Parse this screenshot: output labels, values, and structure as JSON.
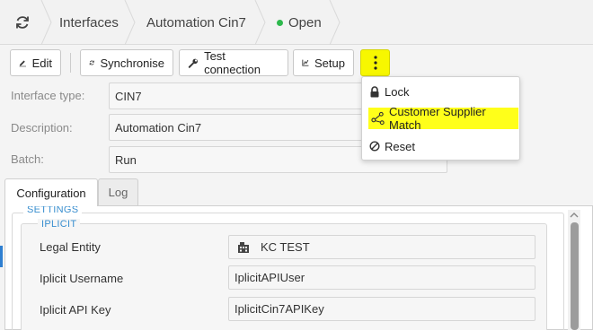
{
  "breadcrumb": {
    "items": [
      "Interfaces",
      "Automation Cin7",
      "Open"
    ],
    "status_color": "#2db84c"
  },
  "toolbar": {
    "edit_label": "Edit",
    "sync_label": "Synchronise",
    "test_label": "Test connection",
    "setup_label": "Setup",
    "more_icon": "kebab-menu-icon",
    "highlight_color": "#f7f700"
  },
  "form": {
    "type_label": "Interface type:",
    "type_value": "CIN7",
    "desc_label": "Description:",
    "desc_value": "Automation Cin7",
    "batch_label": "Batch:",
    "batch_value": "Run"
  },
  "tabs": {
    "configuration": "Configuration",
    "log": "Log"
  },
  "settings": {
    "section_title": "SETTINGS",
    "group_title": "IPLICIT",
    "rows": [
      {
        "label": "Legal Entity",
        "value": "KC TEST",
        "icon": "building-icon"
      },
      {
        "label": "Iplicit Username",
        "value": "IplicitAPIUser"
      },
      {
        "label": "Iplicit API Key",
        "value": "IplicitCin7APIKey"
      }
    ]
  },
  "menu": {
    "items": [
      {
        "label": "Lock",
        "icon": "lock-icon"
      },
      {
        "label": "Customer Supplier Match",
        "icon": "share-nodes-icon"
      },
      {
        "label": "Reset",
        "icon": "ban-icon"
      }
    ],
    "highlight_color": "#ffff1a"
  }
}
